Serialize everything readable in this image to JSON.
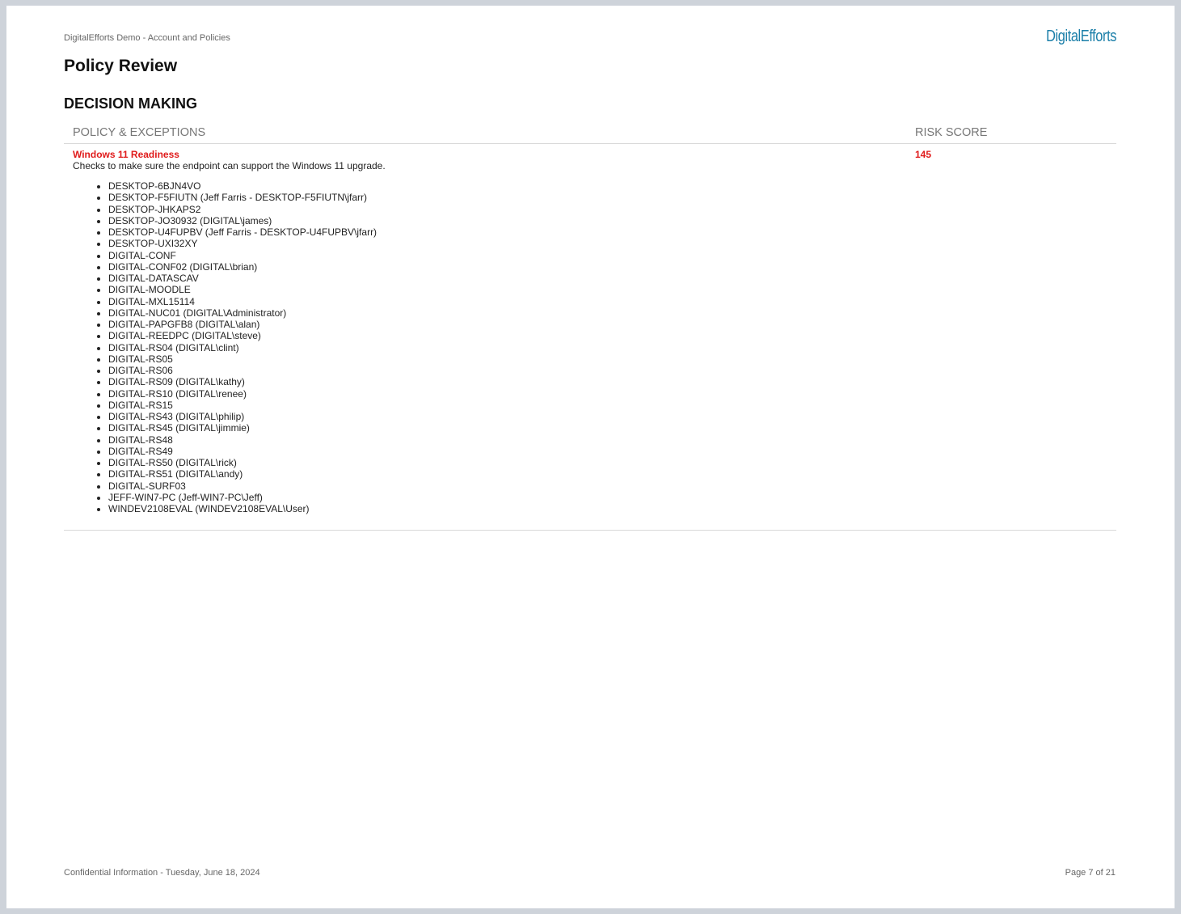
{
  "header": {
    "report_title": "DigitalEfforts Demo - Account and Policies",
    "brand": "DigitalEfforts"
  },
  "page_title": "Policy Review",
  "section_title": "DECISION MAKING",
  "table": {
    "columns": {
      "policy": "POLICY & EXCEPTIONS",
      "risk": "RISK SCORE"
    },
    "rows": [
      {
        "name": "Windows 11 Readiness",
        "description": "Checks to make sure the endpoint can support the Windows 11 upgrade.",
        "risk_score": "145",
        "exceptions": [
          "DESKTOP-6BJN4VO",
          "DESKTOP-F5FIUTN (Jeff Farris - DESKTOP-F5FIUTN\\jfarr)",
          "DESKTOP-JHKAPS2",
          "DESKTOP-JO30932 (DIGITAL\\james)",
          "DESKTOP-U4FUPBV (Jeff Farris - DESKTOP-U4FUPBV\\jfarr)",
          "DESKTOP-UXI32XY",
          "DIGITAL-CONF",
          "DIGITAL-CONF02 (DIGITAL\\brian)",
          "DIGITAL-DATASCAV",
          "DIGITAL-MOODLE",
          "DIGITAL-MXL15114",
          "DIGITAL-NUC01 (DIGITAL\\Administrator)",
          "DIGITAL-PAPGFB8 (DIGITAL\\alan)",
          "DIGITAL-REEDPC (DIGITAL\\steve)",
          "DIGITAL-RS04 (DIGITAL\\clint)",
          "DIGITAL-RS05",
          "DIGITAL-RS06",
          "DIGITAL-RS09 (DIGITAL\\kathy)",
          "DIGITAL-RS10 (DIGITAL\\renee)",
          "DIGITAL-RS15",
          "DIGITAL-RS43 (DIGITAL\\philip)",
          "DIGITAL-RS45 (DIGITAL\\jimmie)",
          "DIGITAL-RS48",
          "DIGITAL-RS49",
          "DIGITAL-RS50 (DIGITAL\\rick)",
          "DIGITAL-RS51 (DIGITAL\\andy)",
          "DIGITAL-SURF03",
          "JEFF-WIN7-PC (Jeff-WIN7-PC\\Jeff)",
          "WINDEV2108EVAL (WINDEV2108EVAL\\User)"
        ]
      }
    ]
  },
  "footer": {
    "left": "Confidential Information - Tuesday, June 18, 2024",
    "right": "Page 7 of 21"
  },
  "colors": {
    "brand": "#1b7fa9",
    "accent_red": "#e01b1b",
    "background": "#ced3da"
  }
}
